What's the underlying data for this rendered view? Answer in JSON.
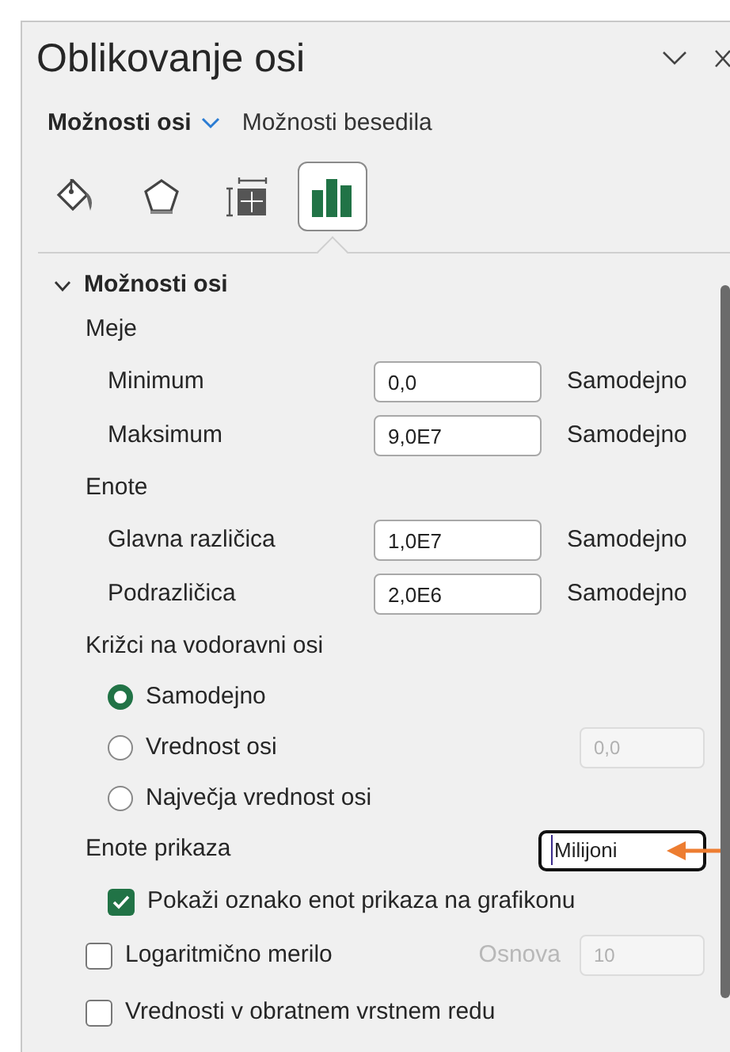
{
  "panel": {
    "title": "Oblikovanje osi",
    "tabs": [
      {
        "label": "Možnosti osi",
        "selected": true
      },
      {
        "label": "Možnosti besedila",
        "selected": false
      }
    ],
    "icon_tabs": [
      {
        "kind": "fill",
        "selected": false
      },
      {
        "kind": "pentagon",
        "selected": false
      },
      {
        "kind": "size",
        "selected": false
      },
      {
        "kind": "bars",
        "selected": true
      }
    ],
    "section": {
      "title": "Možnosti osi",
      "expanded": true,
      "rows": [
        {
          "kind": "heading",
          "label": "Meje"
        },
        {
          "kind": "field",
          "label": "Minimum",
          "value": "0,0",
          "reading": "Samodejno"
        },
        {
          "kind": "field",
          "label": "Maksimum",
          "value": "9,0E7",
          "reading": "Samodejno"
        },
        {
          "kind": "heading",
          "label": "Enote"
        },
        {
          "kind": "field",
          "label": "Glavna različica",
          "value": "1,0E7",
          "reading": "Samodejno"
        },
        {
          "kind": "field",
          "label": "Podrazličica",
          "value": "2,0E6",
          "reading": "Samodejno"
        },
        {
          "kind": "heading",
          "label": "Križci na vodoravni osi"
        },
        {
          "kind": "radio",
          "label": "Samodejno",
          "selected": true
        },
        {
          "kind": "radio",
          "label": "Vrednost osi",
          "selected": false,
          "value": "0,0"
        },
        {
          "kind": "radio",
          "label": "Največja vrednost osi",
          "selected": false
        },
        {
          "kind": "dropdown",
          "label": "Enote prikaza",
          "value": "Milijoni"
        },
        {
          "kind": "checkbox",
          "label": "Pokaži oznako enot prikaza na grafikonu",
          "checked": true,
          "indented": true
        },
        {
          "kind": "checkbox",
          "label": "Logaritmično merilo",
          "checked": false,
          "indented": false,
          "side_label": "Osnova",
          "value": "10"
        },
        {
          "kind": "checkbox",
          "label": "Vrednosti v obratnem vrstnem redu",
          "checked": false,
          "indented": false
        }
      ]
    }
  }
}
